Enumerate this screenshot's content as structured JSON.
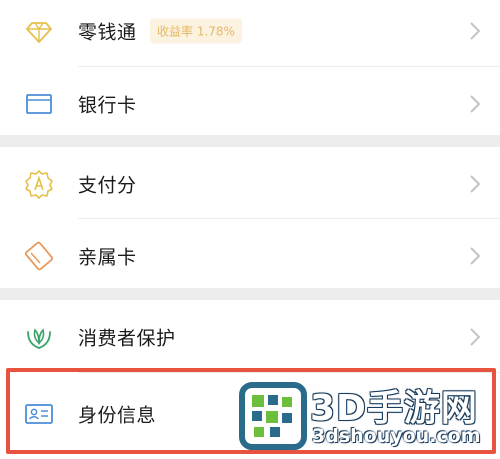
{
  "menu": {
    "group1": [
      {
        "label": "零钱通",
        "badge": "收益率 1.78%",
        "icon": "diamond-icon"
      },
      {
        "label": "银行卡",
        "icon": "bank-card-icon"
      }
    ],
    "group2": [
      {
        "label": "支付分",
        "icon": "badge-a-icon"
      },
      {
        "label": "亲属卡",
        "icon": "family-card-icon"
      }
    ],
    "group3": [
      {
        "label": "消费者保护",
        "icon": "hands-leaf-icon"
      },
      {
        "label": "身份信息",
        "icon": "id-card-icon"
      }
    ]
  },
  "watermark": {
    "brand": "3D手游网",
    "url": "3dshouyou.com"
  },
  "colors": {
    "accent_gold": "#e6b865",
    "accent_blue": "#4a8fd6",
    "highlight": "#e8533f",
    "separator": "#ededed"
  }
}
